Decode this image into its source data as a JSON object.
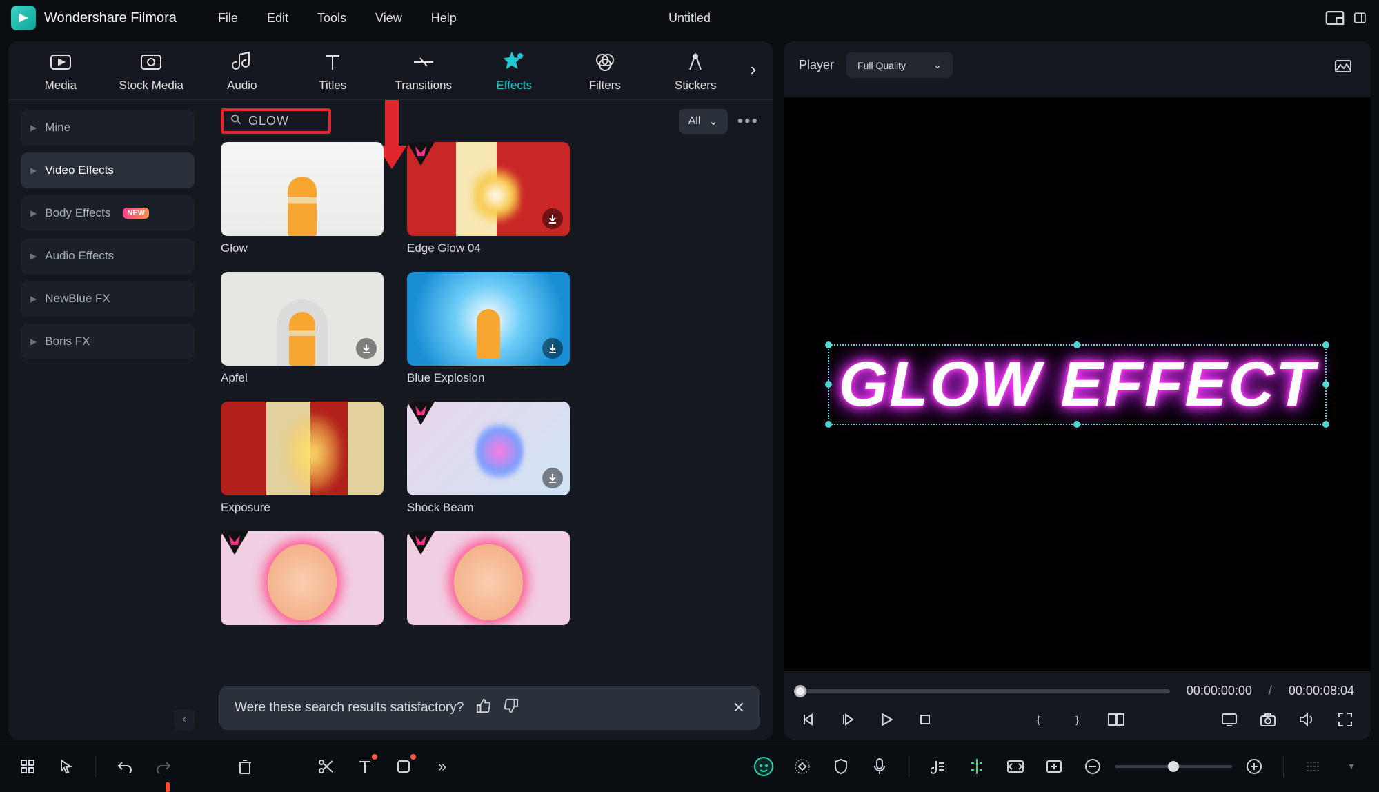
{
  "app": {
    "title": "Wondershare Filmora",
    "document": "Untitled"
  },
  "menu": [
    "File",
    "Edit",
    "Tools",
    "View",
    "Help"
  ],
  "library_tabs": [
    {
      "name": "Media"
    },
    {
      "name": "Stock Media"
    },
    {
      "name": "Audio"
    },
    {
      "name": "Titles"
    },
    {
      "name": "Transitions"
    },
    {
      "name": "Effects",
      "active": true
    },
    {
      "name": "Filters"
    },
    {
      "name": "Stickers"
    }
  ],
  "sidebar": {
    "items": [
      {
        "label": "Mine"
      },
      {
        "label": "Video Effects",
        "selected": true
      },
      {
        "label": "Body Effects",
        "badge": "NEW"
      },
      {
        "label": "Audio Effects"
      },
      {
        "label": "NewBlue FX"
      },
      {
        "label": "Boris FX"
      }
    ]
  },
  "search": {
    "placeholder": "",
    "value": "GLOW"
  },
  "filter": {
    "label": "All"
  },
  "effects": [
    {
      "label": "Glow",
      "thumb": "t-glow",
      "download": false,
      "premium": false
    },
    {
      "label": "Edge Glow 04",
      "thumb": "t-edge",
      "download": true,
      "premium": true
    },
    {
      "label": "Apfel",
      "thumb": "t-apfel",
      "download": true,
      "premium": false
    },
    {
      "label": "Blue Explosion",
      "thumb": "t-blue",
      "download": true,
      "premium": false
    },
    {
      "label": "Exposure",
      "thumb": "t-exp",
      "download": false,
      "premium": false
    },
    {
      "label": "Shock Beam",
      "thumb": "t-shock",
      "download": true,
      "premium": true
    },
    {
      "label": "",
      "thumb": "t-pink",
      "download": false,
      "premium": true
    },
    {
      "label": "",
      "thumb": "t-pink",
      "download": false,
      "premium": true
    }
  ],
  "feedback": {
    "text": "Were these search results satisfactory?"
  },
  "player": {
    "label": "Player",
    "quality": "Full Quality",
    "preview_text": "GLOW EFFECT",
    "time_current": "00:00:00:00",
    "time_total": "00:00:08:04",
    "separator": "/"
  }
}
